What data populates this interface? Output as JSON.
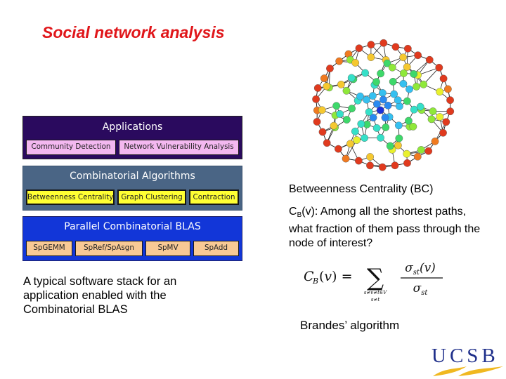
{
  "slide": {
    "title": "Social network analysis",
    "title_color": "#e0161a"
  },
  "stack": {
    "applications": {
      "heading": "Applications",
      "items": [
        "Community Detection",
        "Network Vulnerability Analysis"
      ],
      "bg_color": "#2a0a5e",
      "item_color": "#f3b8f0"
    },
    "algorithms": {
      "heading": "Combinatorial Algorithms",
      "items": [
        "Betweenness Centrality",
        "Graph Clustering",
        "Contraction"
      ],
      "bg_color": "#4a6585",
      "item_color": "#ffff33"
    },
    "blas": {
      "heading": "Parallel Combinatorial BLAS",
      "items": [
        "SpGEMM",
        "SpRef/SpAsgn",
        "SpMV",
        "SpAdd"
      ],
      "bg_color": "#1236d8",
      "item_color": "#f8c995"
    },
    "caption": "A typical software stack for an application enabled with the Combinatorial BLAS"
  },
  "bc": {
    "title": "Betweenness Centrality (BC)",
    "desc_prefix": "C",
    "desc_sub": "B",
    "desc_rest": "(v): Among all the shortest paths, what fraction of them pass through the node of interest?",
    "formula": {
      "lhs": "C_B(v) =",
      "sum_under": "s≠v≠t∈V",
      "sum_under2": "s≠t",
      "numerator": "σ_st(v)",
      "denominator": "σ_st"
    },
    "algorithm_label": "Brandes’ algorithm"
  },
  "graph": {
    "description": "network graph with nodes colored by betweenness centrality (red = low on perimeter, blue = high in center)",
    "color_scale": [
      "#e03a1e",
      "#f07a20",
      "#f5c830",
      "#e8f02e",
      "#8fe83a",
      "#3ed86a",
      "#35e0c8",
      "#35c0f0",
      "#2a8af0",
      "#1a30d8"
    ]
  },
  "logo": {
    "text": "UCSB",
    "text_color": "#1f2f8a",
    "wave_color": "#f0b820"
  }
}
